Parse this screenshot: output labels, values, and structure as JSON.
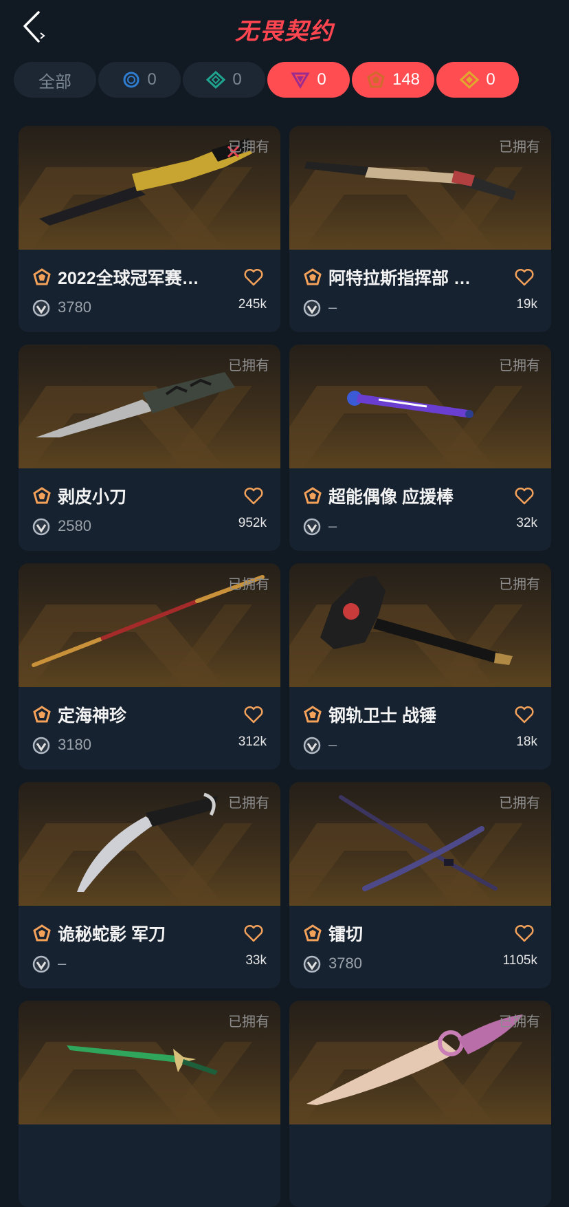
{
  "header": {
    "title": "无畏契约"
  },
  "filters": [
    {
      "label": "全部",
      "count": ""
    },
    {
      "icon": "select-tier-icon",
      "count": "0",
      "color": "#2f7dd0"
    },
    {
      "icon": "deluxe-tier-icon",
      "count": "0",
      "color": "#1fa58f"
    },
    {
      "icon": "premium-tier-icon",
      "count": "0",
      "color": "#c24bb0"
    },
    {
      "icon": "exclusive-tier-icon",
      "count": "148",
      "color": "#f4a25a"
    },
    {
      "icon": "ultra-tier-icon",
      "count": "0",
      "color": "#f2c14e"
    }
  ],
  "owned_label": "已拥有",
  "items": [
    {
      "name": "2022全球冠军赛…",
      "price": "3780",
      "likes": "245k"
    },
    {
      "name": "阿特拉斯指挥部 甩棍",
      "price": "–",
      "likes": "19k"
    },
    {
      "name": "剥皮小刀",
      "price": "2580",
      "likes": "952k"
    },
    {
      "name": "超能偶像 应援棒",
      "price": "–",
      "likes": "32k"
    },
    {
      "name": "定海神珍",
      "price": "3180",
      "likes": "312k"
    },
    {
      "name": "钢轨卫士 战锤",
      "price": "–",
      "likes": "18k"
    },
    {
      "name": "诡秘蛇影 军刀",
      "price": "–",
      "likes": "33k"
    },
    {
      "name": "镭切",
      "price": "3780",
      "likes": "1105k"
    },
    {
      "name": "",
      "price": "",
      "likes": ""
    },
    {
      "name": "",
      "price": "",
      "likes": ""
    }
  ],
  "colors": {
    "accent": "#ff4d52",
    "tier_exclusive": "#f4a25a",
    "heart": "#f4a25a",
    "background": "#111923",
    "card": "#172230"
  }
}
